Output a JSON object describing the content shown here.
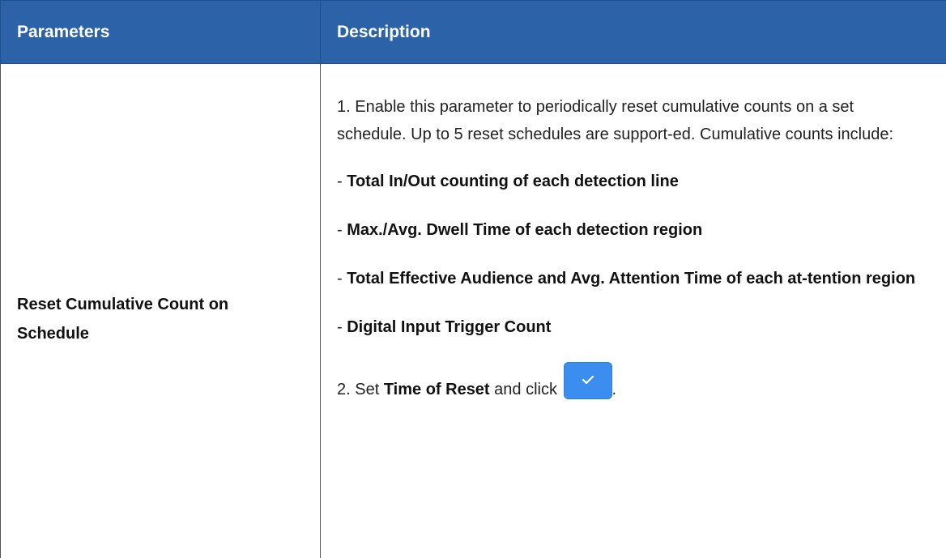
{
  "table": {
    "headers": {
      "parameters": "Parameters",
      "description": "Description"
    },
    "row": {
      "parameter": "Reset Cumulative Count on Schedule",
      "description": {
        "item1": "1. Enable this parameter to periodically reset cumulative counts on a set schedule. Up to 5 reset schedules are support-ed. Cumulative counts include:",
        "bullets": [
          {
            "prefix": "- ",
            "text": "Total In/Out counting of each detection line"
          },
          {
            "prefix": "- ",
            "text": "Max./Avg. Dwell Time of each detection region"
          },
          {
            "prefix": "- ",
            "text": "Total Effective Audience and Avg. Attention Time of each at-tention region"
          },
          {
            "prefix": "- ",
            "text": "Digital Input Trigger Count"
          }
        ],
        "step2": {
          "prefix": "2. Set ",
          "bold": "Time of Reset",
          "middle": " and click ",
          "suffix": "."
        }
      }
    }
  },
  "icons": {
    "confirm_button": "checkmark-icon"
  },
  "colors": {
    "header_bg": "#2c63a8",
    "header_text": "#ffffff",
    "confirm_button_bg": "#3b8ef0"
  }
}
